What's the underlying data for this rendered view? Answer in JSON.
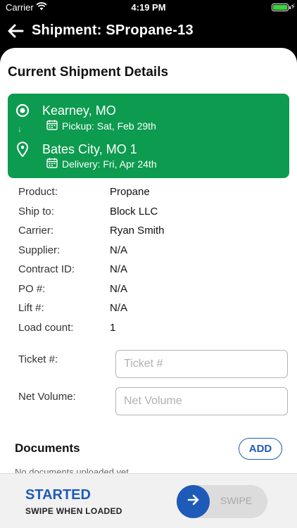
{
  "status_bar": {
    "carrier": "Carrier",
    "time": "4:19 PM",
    "battery_color": "#3cd33c"
  },
  "nav": {
    "title": "Shipment: SPropane-13",
    "back_icon": "arrow-left-icon"
  },
  "section_title": "Current Shipment Details",
  "route": {
    "origin_city": "Kearney, MO",
    "pickup": "Pickup: Sat, Feb 29th",
    "destination_city": "Bates City, MO 1",
    "delivery": "Delivery: Fri, Apr 24th",
    "card_color": "#0d9b4f"
  },
  "details": [
    {
      "label": "Product:",
      "value": "Propane"
    },
    {
      "label": "Ship to:",
      "value": "Block LLC"
    },
    {
      "label": "Carrier:",
      "value": "Ryan Smith"
    },
    {
      "label": "Supplier:",
      "value": "N/A"
    },
    {
      "label": "Contract ID:",
      "value": "N/A"
    },
    {
      "label": "PO #:",
      "value": "N/A"
    },
    {
      "label": "Lift #:",
      "value": "N/A"
    },
    {
      "label": "Load count:",
      "value": "1"
    }
  ],
  "ticket": {
    "label": "Ticket #:",
    "placeholder": "Ticket #",
    "value": ""
  },
  "net_volume": {
    "label": "Net Volume:",
    "placeholder": "Net Volume",
    "value": ""
  },
  "documents": {
    "title": "Documents",
    "add_label": "ADD",
    "empty_text": "No documents uploaded yet"
  },
  "bottom": {
    "status": "STARTED",
    "hint": "SWIPE WHEN LOADED",
    "swipe_label": "SWIPE",
    "accent_color": "#1e5bb8"
  }
}
